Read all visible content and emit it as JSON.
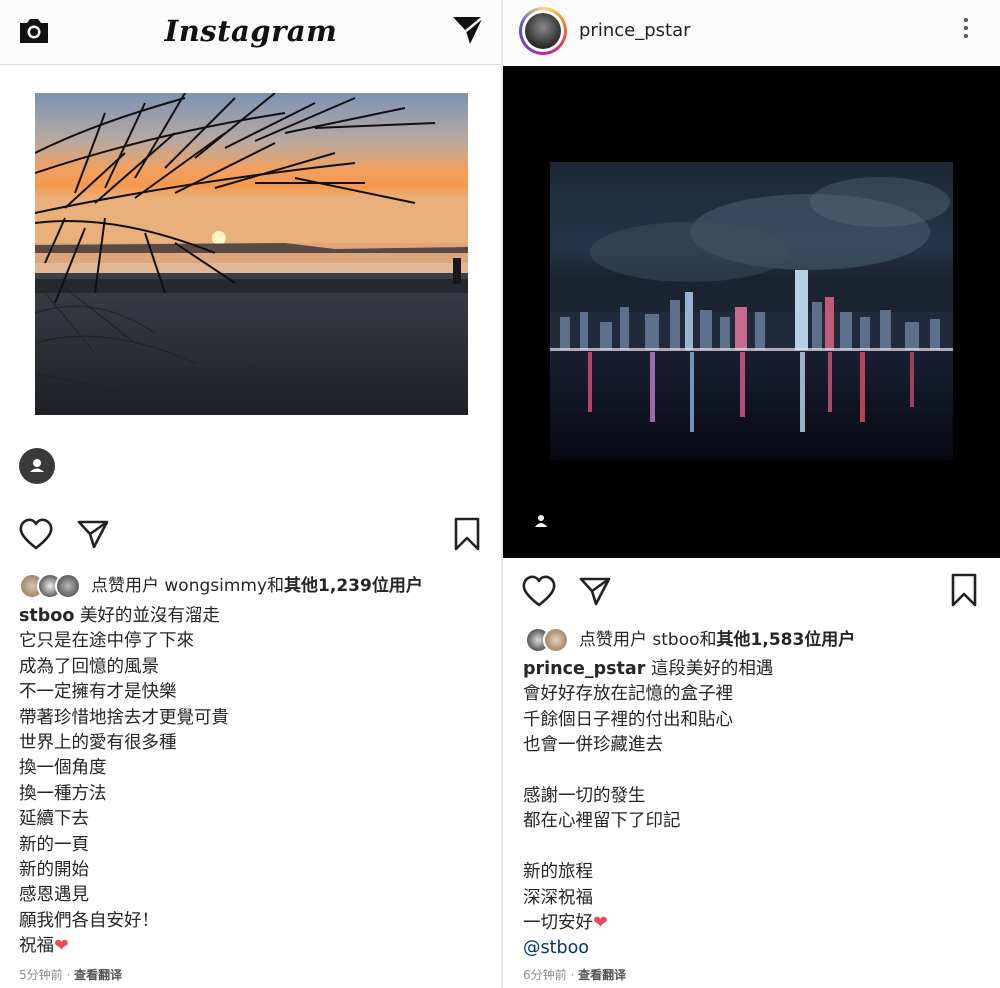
{
  "left_post": {
    "header": {
      "app_title": "Instagram",
      "camera_icon": "camera-icon",
      "direct_icon": "paper-plane-icon"
    },
    "actions": {
      "like_icon": "heart-outline-icon",
      "share_icon": "paper-plane-icon",
      "save_icon": "bookmark-icon"
    },
    "likes": {
      "prefix": "点赞用户 ",
      "user": "wongsimmy",
      "and_text": "和",
      "others": "其他1,239位用户"
    },
    "caption": {
      "username": "stboo",
      "first_line": " 美好的並沒有溜走",
      "lines": [
        "它只是在途中停了下來",
        "成為了回憶的風景",
        "不一定擁有才是快樂",
        "帶著珍惜地捨去才更覺可貴",
        "世界上的愛有很多種",
        "換一個角度",
        "換一種方法",
        "延續下去",
        "新的一頁",
        "新的開始",
        "感恩遇見",
        "願我們各自安好！"
      ],
      "last_line": "祝福",
      "heart": "❤"
    },
    "meta": {
      "time": "5分钟前 · ",
      "translate": "查看翻译"
    }
  },
  "right_post": {
    "header": {
      "username": "prince_pstar",
      "more_icon": "more-vertical-icon"
    },
    "actions": {
      "like_icon": "heart-outline-icon",
      "share_icon": "paper-plane-icon",
      "save_icon": "bookmark-icon"
    },
    "likes": {
      "prefix": "点赞用户 ",
      "user": "stboo",
      "and_text": "和",
      "others": "其他1,583位用户"
    },
    "caption": {
      "username": "prince_pstar",
      "first_line": " 這段美好的相遇",
      "lines_a": [
        "會好好存放在記憶的盒子裡",
        "千餘個日子裡的付出和貼心",
        "也會一併珍藏進去"
      ],
      "lines_b": [
        "感謝一切的發生",
        "都在心裡留下了印記"
      ],
      "lines_c": [
        "新的旅程",
        "深深祝福"
      ],
      "last_line": "一切安好",
      "heart": "❤",
      "mention": "@stboo"
    },
    "meta": {
      "time": "6分钟前 · ",
      "translate": "查看翻译"
    }
  },
  "colors": {
    "like_red": "#ed4956",
    "mention_blue": "#00376b",
    "meta_gray": "#8e8e8e"
  }
}
